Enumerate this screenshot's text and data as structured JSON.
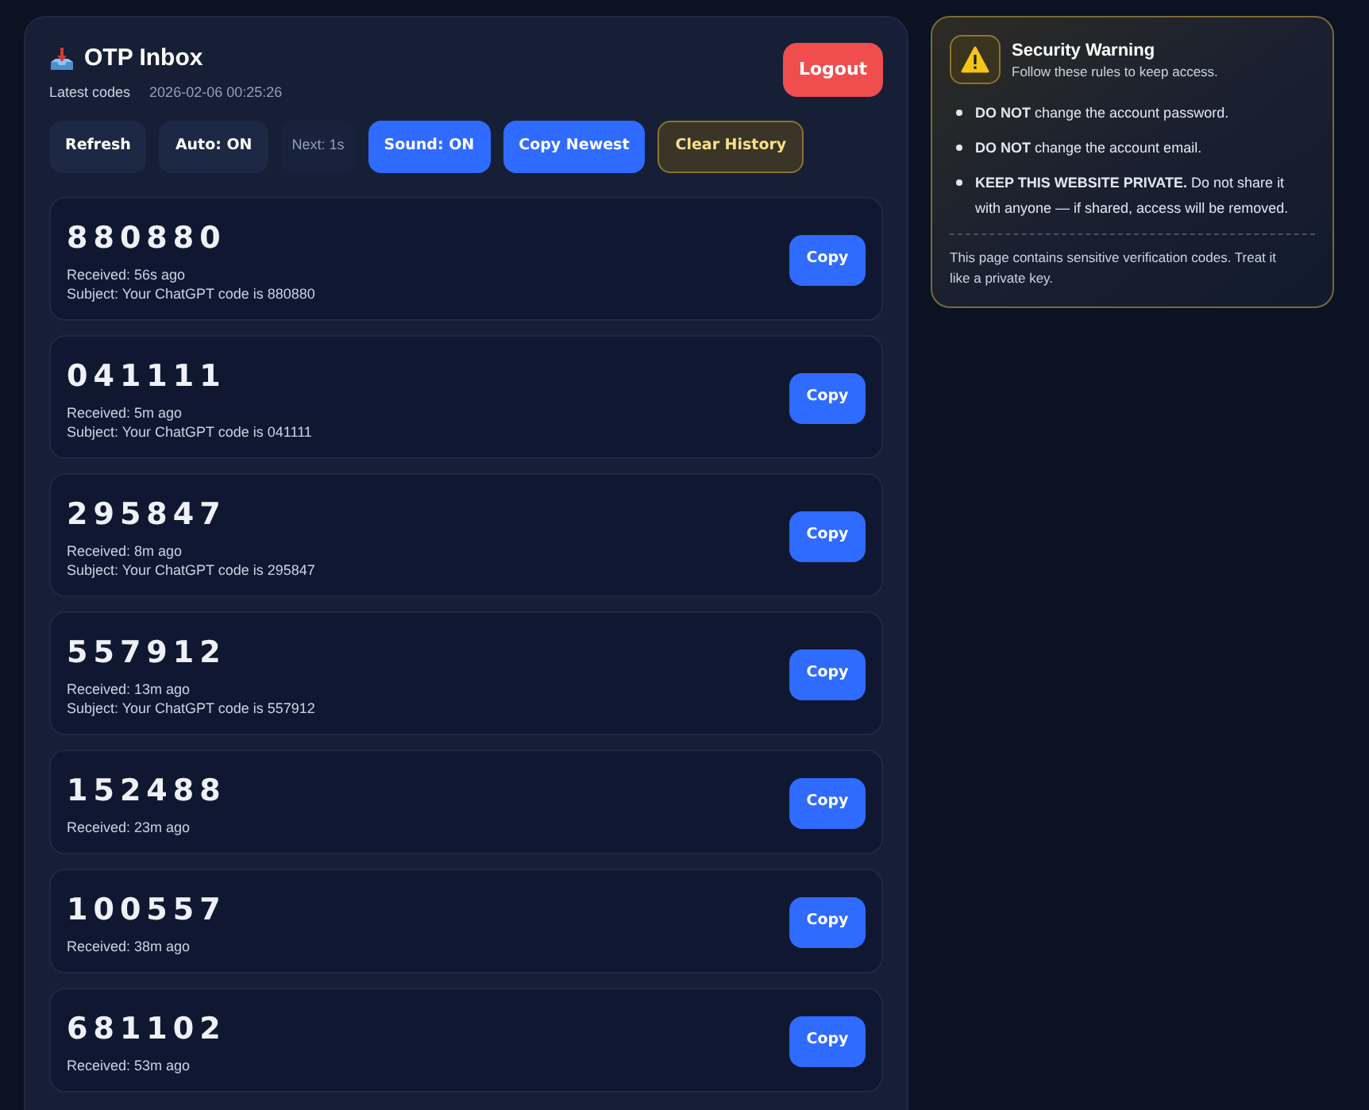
{
  "header": {
    "title": "OTP Inbox",
    "subtitle": "Latest codes",
    "timestamp": "2026-02-06 00:25:26",
    "logout": "Logout"
  },
  "toolbar": [
    {
      "kind": "secondary",
      "label": "Refresh"
    },
    {
      "kind": "secondary",
      "label": "Auto: ON"
    },
    {
      "kind": "status",
      "label": "Next: 1s"
    },
    {
      "kind": "primary",
      "label": "Sound: ON"
    },
    {
      "kind": "primary",
      "label": "Copy Newest"
    },
    {
      "kind": "warning",
      "label": "Clear History"
    }
  ],
  "codes": [
    {
      "code": "880880",
      "received": "Received: 56s ago",
      "subject": "Subject: Your ChatGPT code is 880880",
      "copy": "Copy"
    },
    {
      "code": "041111",
      "received": "Received: 5m ago",
      "subject": "Subject: Your ChatGPT code is 041111",
      "copy": "Copy"
    },
    {
      "code": "295847",
      "received": "Received: 8m ago",
      "subject": "Subject: Your ChatGPT code is 295847",
      "copy": "Copy"
    },
    {
      "code": "557912",
      "received": "Received: 13m ago",
      "subject": "Subject: Your ChatGPT code is 557912",
      "copy": "Copy"
    },
    {
      "code": "152488",
      "received": "Received: 23m ago",
      "copy": "Copy"
    },
    {
      "code": "100557",
      "received": "Received: 38m ago",
      "copy": "Copy"
    },
    {
      "code": "681102",
      "received": "Received: 53m ago",
      "copy": "Copy"
    }
  ],
  "warning": {
    "title": "Security Warning",
    "subtitle": "Follow these rules to keep access.",
    "rules": [
      "**DO NOT** change the account password.",
      "**DO NOT** change the account email.",
      "**KEEP THIS WEBSITE PRIVATE.** Do not share it with anyone — if shared, access will be removed."
    ],
    "note": "This page contains sensitive verification codes. Treat it like a private key."
  }
}
